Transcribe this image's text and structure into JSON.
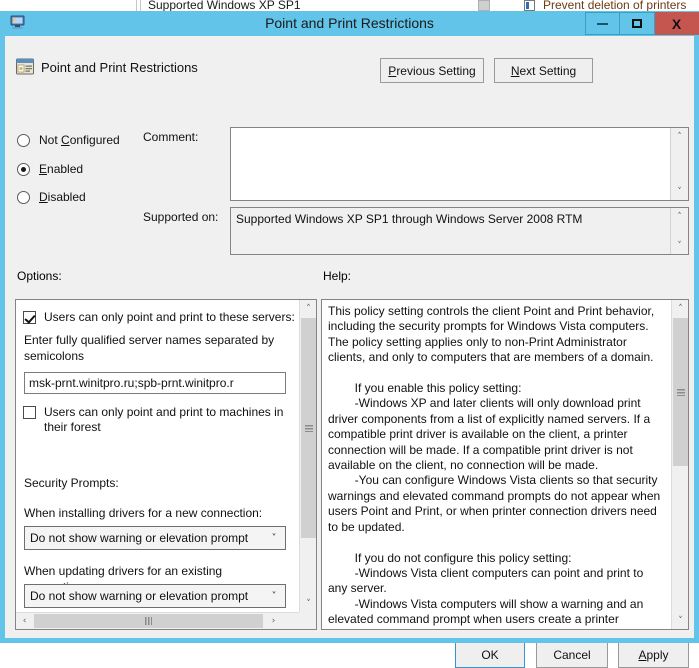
{
  "background_window": {
    "item_left": "Supported Windows XP SP1",
    "item_right": "Prevent deletion of printers"
  },
  "window": {
    "title": "Point and Print Restrictions",
    "icon": "policy-window-icon",
    "controls": {
      "minimize": "minimize-icon",
      "maximize": "maximize-icon",
      "close": "X"
    }
  },
  "header": {
    "icon": "policy-setting-icon",
    "title": "Point and Print Restrictions",
    "previous_button": {
      "accel": "P",
      "rest": "revious Setting"
    },
    "next_button": {
      "accel": "N",
      "rest": "ext Setting"
    }
  },
  "state": {
    "options": [
      {
        "name": "not-configured",
        "accel_pre": "Not ",
        "accel": "C",
        "accel_post": "onfigured",
        "selected": false
      },
      {
        "name": "enabled",
        "accel_pre": "",
        "accel": "E",
        "accel_post": "nabled",
        "selected": true
      },
      {
        "name": "disabled",
        "accel_pre": "",
        "accel": "D",
        "accel_post": "isabled",
        "selected": false
      }
    ]
  },
  "comment": {
    "label": "Comment:",
    "value": ""
  },
  "supported_on": {
    "label": "Supported on:",
    "value": "Supported Windows XP SP1 through Windows Server 2008 RTM"
  },
  "sections": {
    "options_label": "Options:",
    "help_label": "Help:"
  },
  "options": {
    "checkbox_servers": {
      "label": "Users can only point and print to these servers:",
      "checked": true
    },
    "servers_hint": "Enter fully qualified server names separated by semicolons",
    "servers_value": "msk-prnt.winitpro.ru;spb-prnt.winitpro.r",
    "checkbox_forest": {
      "label": "Users can only point and print to machines in their forest",
      "checked": false
    },
    "security_prompts_label": "Security Prompts:",
    "install_label": "When installing drivers for a new connection:",
    "install_value": "Do not show warning or elevation prompt",
    "update_label": "When updating drivers for an existing connection:",
    "update_value": "Do not show warning or elevation prompt"
  },
  "help": {
    "text": "This policy setting controls the client Point and Print behavior, including the security prompts for Windows Vista computers. The policy setting applies only to non-Print Administrator clients, and only to computers that are members of a domain.\n\n        If you enable this policy setting:\n        -Windows XP and later clients will only download print driver components from a list of explicitly named servers. If a compatible print driver is available on the client, a printer connection will be made. If a compatible print driver is not available on the client, no connection will be made.\n        -You can configure Windows Vista clients so that security warnings and elevated command prompts do not appear when users Point and Print, or when printer connection drivers need to be updated.\n\n        If you do not configure this policy setting:\n        -Windows Vista client computers can point and print to any server.\n        -Windows Vista computers will show a warning and an elevated command prompt when users create a printer"
  },
  "footer": {
    "ok": "OK",
    "cancel": "Cancel",
    "apply_accel": "A",
    "apply_rest": "pply"
  },
  "icons": {
    "scroll_up": "˄",
    "scroll_down": "˅",
    "scroll_left": "‹",
    "scroll_right": "›",
    "dropdown": "˅"
  },
  "colors": {
    "titlebar": "#62c4e8",
    "close_button": "#c4564f",
    "dialog_face": "#f0f0f0",
    "focus_border": "#3a93c9"
  }
}
